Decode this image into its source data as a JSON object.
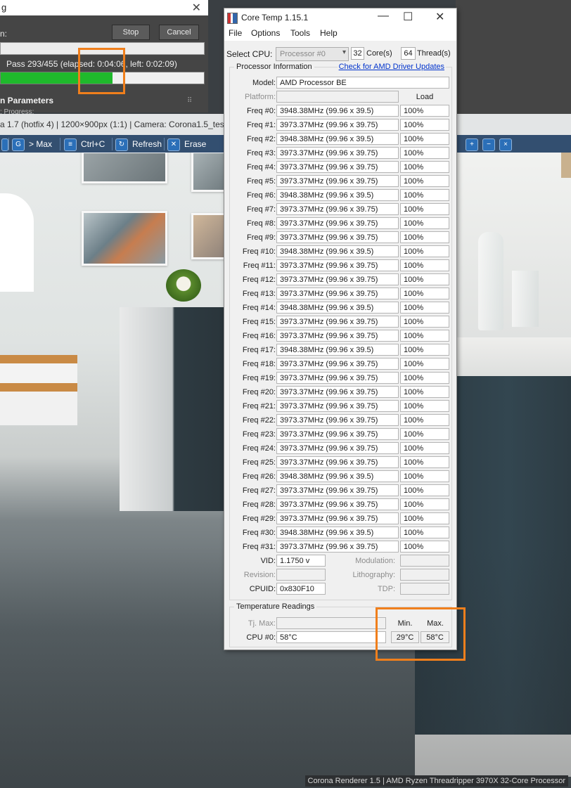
{
  "render_window": {
    "title_fragment": "g",
    "colon_label": "n:",
    "stop_label": "Stop",
    "cancel_label": "Cancel",
    "pass_text": "Pass 293/455 (elapsed: 0:04:06, left: 0:02:09)",
    "progress_fraction": 0.55,
    "params_title": "n Parameters",
    "params_sub": ": Progress:",
    "info_bar": "a 1.7 (hotfix 4) | 1200×900px (1:1) | Camera: Corona1.5_test_sc",
    "toolbar": {
      "max_label": "> Max",
      "copy_label": "Ctrl+C",
      "refresh_label": "Refresh",
      "erase_label": "Erase"
    },
    "footer": "Corona Renderer 1.5 | AMD Ryzen Threadripper 3970X 32-Core Processor"
  },
  "coretemp": {
    "title": "Core Temp 1.15.1",
    "menu": [
      "File",
      "Options",
      "Tools",
      "Help"
    ],
    "select_cpu_label": "Select CPU:",
    "processor_option": "Processor #0",
    "cores_count": "32",
    "cores_label": "Core(s)",
    "threads_count": "64",
    "threads_label": "Thread(s)",
    "processor_info_title": "Processor Information",
    "amd_link": "Check for AMD Driver Updates",
    "model_label": "Model:",
    "model_value": "AMD Processor  BE",
    "platform_label": "Platform:",
    "load_header": "Load",
    "freqs": [
      {
        "label": "Freq #0:",
        "value": "3948.38MHz (99.96 x 39.5)",
        "load": "100%"
      },
      {
        "label": "Freq #1:",
        "value": "3973.37MHz (99.96 x 39.75)",
        "load": "100%"
      },
      {
        "label": "Freq #2:",
        "value": "3948.38MHz (99.96 x 39.5)",
        "load": "100%"
      },
      {
        "label": "Freq #3:",
        "value": "3973.37MHz (99.96 x 39.75)",
        "load": "100%"
      },
      {
        "label": "Freq #4:",
        "value": "3973.37MHz (99.96 x 39.75)",
        "load": "100%"
      },
      {
        "label": "Freq #5:",
        "value": "3973.37MHz (99.96 x 39.75)",
        "load": "100%"
      },
      {
        "label": "Freq #6:",
        "value": "3948.38MHz (99.96 x 39.5)",
        "load": "100%"
      },
      {
        "label": "Freq #7:",
        "value": "3973.37MHz (99.96 x 39.75)",
        "load": "100%"
      },
      {
        "label": "Freq #8:",
        "value": "3973.37MHz (99.96 x 39.75)",
        "load": "100%"
      },
      {
        "label": "Freq #9:",
        "value": "3973.37MHz (99.96 x 39.75)",
        "load": "100%"
      },
      {
        "label": "Freq #10:",
        "value": "3948.38MHz (99.96 x 39.5)",
        "load": "100%"
      },
      {
        "label": "Freq #11:",
        "value": "3973.37MHz (99.96 x 39.75)",
        "load": "100%"
      },
      {
        "label": "Freq #12:",
        "value": "3973.37MHz (99.96 x 39.75)",
        "load": "100%"
      },
      {
        "label": "Freq #13:",
        "value": "3973.37MHz (99.96 x 39.75)",
        "load": "100%"
      },
      {
        "label": "Freq #14:",
        "value": "3948.38MHz (99.96 x 39.5)",
        "load": "100%"
      },
      {
        "label": "Freq #15:",
        "value": "3973.37MHz (99.96 x 39.75)",
        "load": "100%"
      },
      {
        "label": "Freq #16:",
        "value": "3973.37MHz (99.96 x 39.75)",
        "load": "100%"
      },
      {
        "label": "Freq #17:",
        "value": "3948.38MHz (99.96 x 39.5)",
        "load": "100%"
      },
      {
        "label": "Freq #18:",
        "value": "3973.37MHz (99.96 x 39.75)",
        "load": "100%"
      },
      {
        "label": "Freq #19:",
        "value": "3973.37MHz (99.96 x 39.75)",
        "load": "100%"
      },
      {
        "label": "Freq #20:",
        "value": "3973.37MHz (99.96 x 39.75)",
        "load": "100%"
      },
      {
        "label": "Freq #21:",
        "value": "3973.37MHz (99.96 x 39.75)",
        "load": "100%"
      },
      {
        "label": "Freq #22:",
        "value": "3973.37MHz (99.96 x 39.75)",
        "load": "100%"
      },
      {
        "label": "Freq #23:",
        "value": "3973.37MHz (99.96 x 39.75)",
        "load": "100%"
      },
      {
        "label": "Freq #24:",
        "value": "3973.37MHz (99.96 x 39.75)",
        "load": "100%"
      },
      {
        "label": "Freq #25:",
        "value": "3973.37MHz (99.96 x 39.75)",
        "load": "100%"
      },
      {
        "label": "Freq #26:",
        "value": "3948.38MHz (99.96 x 39.5)",
        "load": "100%"
      },
      {
        "label": "Freq #27:",
        "value": "3973.37MHz (99.96 x 39.75)",
        "load": "100%"
      },
      {
        "label": "Freq #28:",
        "value": "3973.37MHz (99.96 x 39.75)",
        "load": "100%"
      },
      {
        "label": "Freq #29:",
        "value": "3973.37MHz (99.96 x 39.75)",
        "load": "100%"
      },
      {
        "label": "Freq #30:",
        "value": "3948.38MHz (99.96 x 39.5)",
        "load": "100%"
      },
      {
        "label": "Freq #31:",
        "value": "3973.37MHz (99.96 x 39.75)",
        "load": "100%"
      }
    ],
    "vid_label": "VID:",
    "vid_value": "1.1750 v",
    "modulation_label": "Modulation:",
    "revision_label": "Revision:",
    "lithography_label": "Lithography:",
    "cpuid_label": "CPUID:",
    "cpuid_value": "0x830F10",
    "tdp_label": "TDP:",
    "temp_title": "Temperature Readings",
    "tjmax_label": "Tj. Max:",
    "min_header": "Min.",
    "max_header": "Max.",
    "cpu0_label": "CPU #0:",
    "cpu0_value": "58°C",
    "cpu0_min": "29°C",
    "cpu0_max": "58°C"
  },
  "colors": {
    "highlight": "#f07f1c",
    "progress": "#1fb92c",
    "link": "#0033cc"
  }
}
